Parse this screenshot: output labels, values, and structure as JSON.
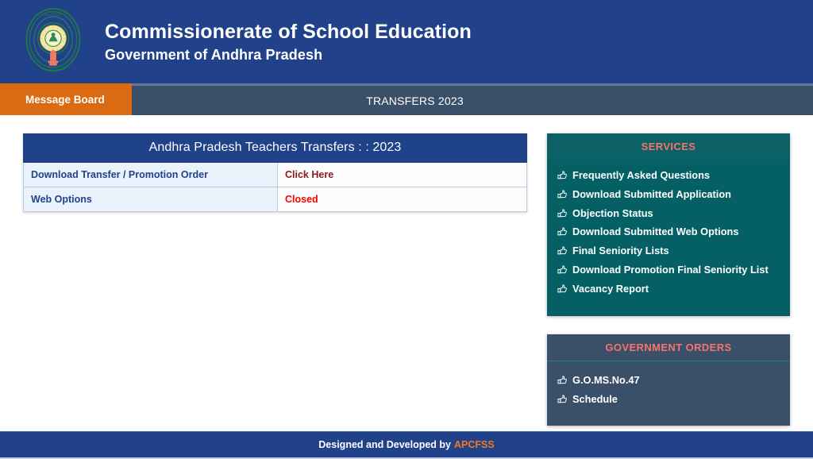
{
  "header": {
    "title": "Commissionerate of School Education",
    "subtitle": "Government of Andhra Pradesh",
    "emblem_name": "andhra-pradesh-government-emblem",
    "bg_color": "#21428a"
  },
  "nav": {
    "message_board_label": "Message Board",
    "transfers_label": "TRANSFERS 2023",
    "active_tab_color": "#db6b12",
    "bar_color": "#3a5069"
  },
  "main_table": {
    "caption": "Andhra Pradesh Teachers Transfers : : 2023",
    "rows": [
      {
        "label": "Download Transfer / Promotion Order",
        "value": "Click Here",
        "value_kind": "link"
      },
      {
        "label": "Web Options",
        "value": "Closed",
        "value_kind": "status"
      }
    ],
    "header_color": "#1f4289",
    "link_color": "#8b1a1a",
    "status_color": "#fa0000"
  },
  "services_panel": {
    "title": "SERVICES",
    "title_color": "#f4756b",
    "bg_color": "#046065",
    "bullet_icon": "pointing-hand-icon",
    "items": [
      "Frequently Asked Questions",
      "Download Submitted Application",
      "Objection Status",
      "Download Submitted Web Options",
      "Final Seniority Lists",
      "Download Promotion Final Seniority List",
      "Vacancy Report"
    ]
  },
  "government_orders_panel": {
    "title": "GOVERNMENT ORDERS",
    "title_color": "#f4756b",
    "bg_color": "#3a5069",
    "bullet_icon": "pointing-hand-icon",
    "items": [
      "G.O.MS.No.47",
      "Schedule"
    ]
  },
  "footer": {
    "text": "Designed and Developed by",
    "brand": "APCFSS",
    "brand_color": "#f07a1e",
    "bg_color": "#21428a"
  }
}
